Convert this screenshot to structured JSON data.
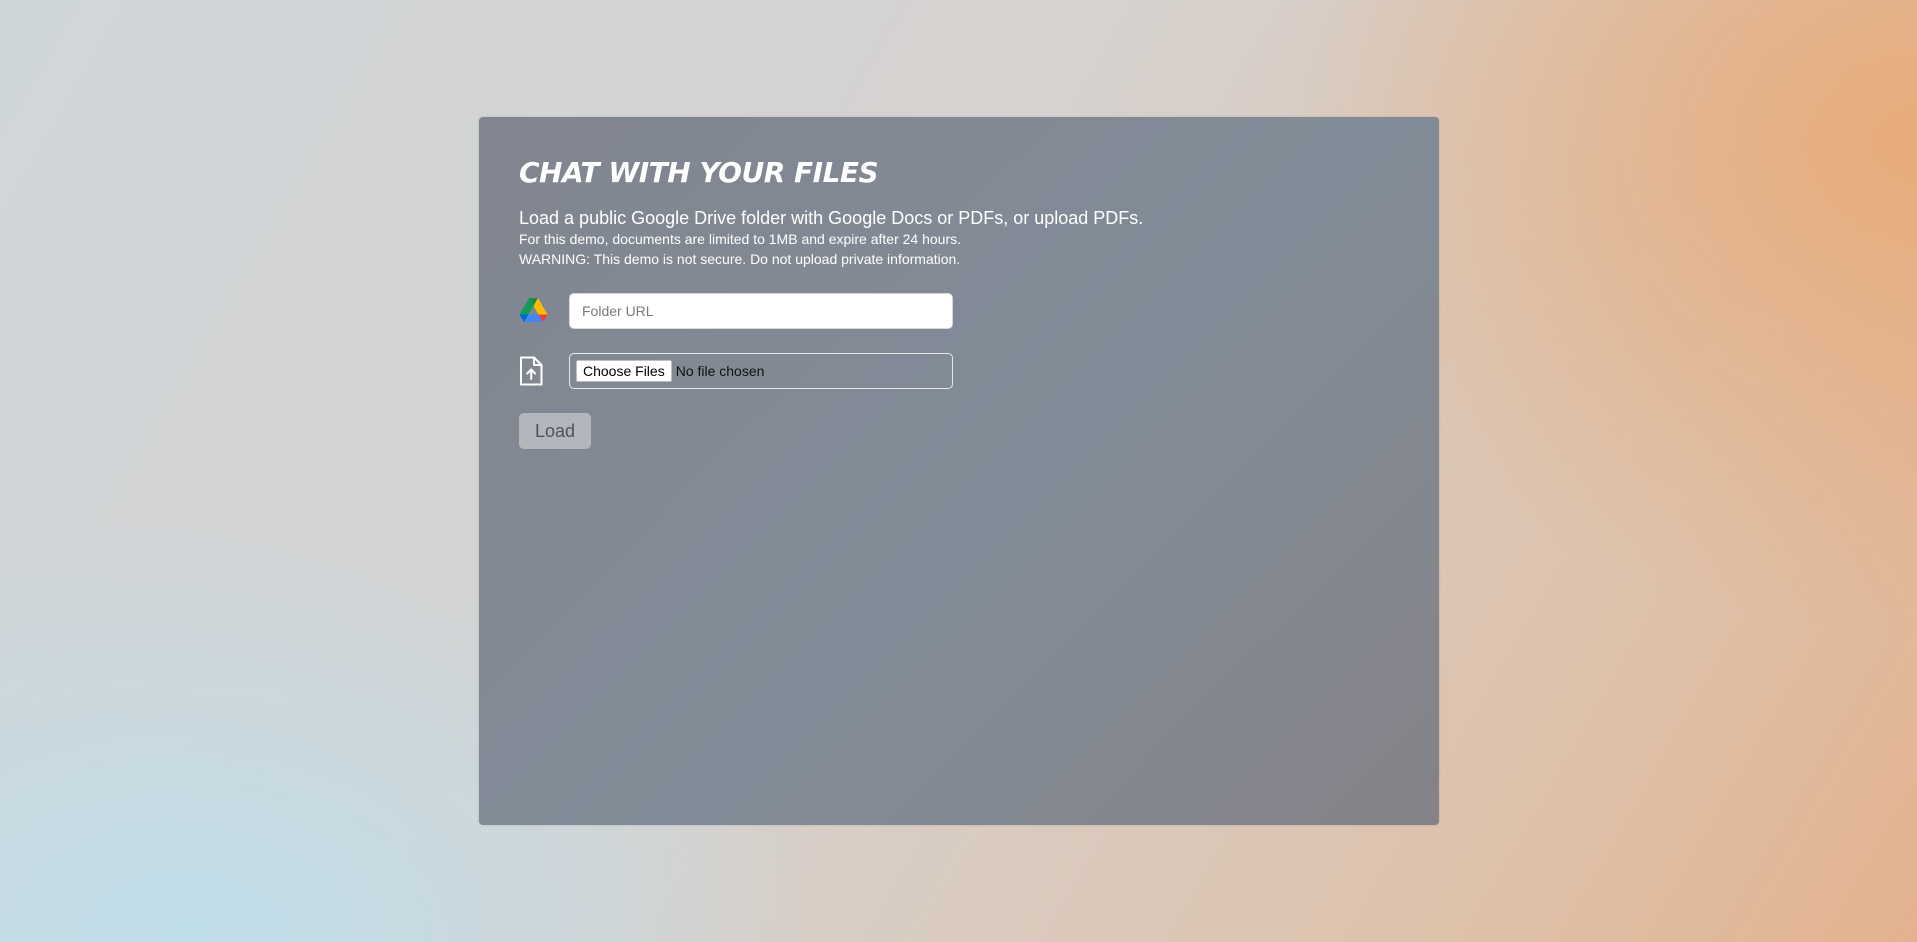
{
  "header": {
    "title": "CHAT WITH YOUR FILES"
  },
  "intro": {
    "subtitle": "Load a public Google Drive folder with Google Docs or PDFs, or upload PDFs.",
    "limit_note": "For this demo, documents are limited to 1MB and expire after 24 hours.",
    "warning_note": "WARNING: This demo is not secure. Do not upload private information."
  },
  "drive": {
    "icon": "google-drive-icon",
    "placeholder": "Folder URL",
    "value": ""
  },
  "upload": {
    "icon": "file-upload-icon",
    "button_label": "Choose Files",
    "status": "No file chosen"
  },
  "actions": {
    "load_label": "Load"
  }
}
